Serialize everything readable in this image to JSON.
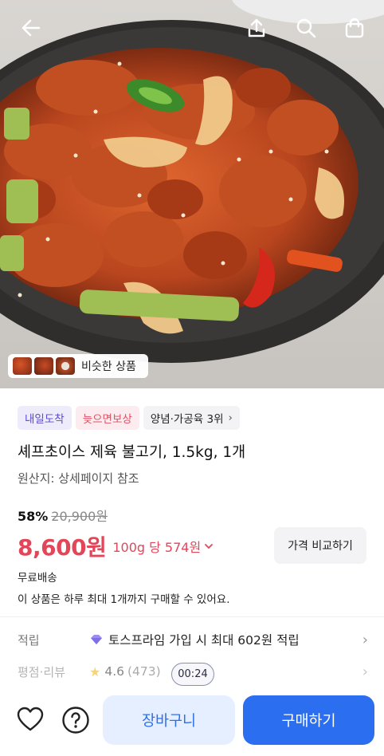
{
  "hero": {
    "similar_label": "비슷한 상품"
  },
  "badges": {
    "arrival": "내일도착",
    "late_comp": "늦으면보상",
    "rank": "양념·가공육 3위"
  },
  "product": {
    "title": "셰프초이스 제육 불고기, 1.5kg, 1개",
    "origin": "원산지: 상세페이지 참조",
    "discount": "58%",
    "original_price": "20,900원",
    "price": "8,600원",
    "unit_price": "100g 당 574원",
    "compare_label": "가격 비교하기",
    "shipping": "무료배송",
    "purchase_limit": "이 상품은 하루 최대 1개까지 구매할 수 있어요."
  },
  "details": {
    "points_key": "적립",
    "points_value": "토스프라임 가입 시 최대 602원 적립",
    "review_key": "평점·리뷰",
    "rating": "4.6",
    "review_count": "(473)",
    "timer": "00:24"
  },
  "actions": {
    "cart_label": "장바구니",
    "buy_label": "구매하기"
  },
  "icons": {
    "back": "arrow-left-icon",
    "share": "share-icon",
    "search": "search-icon",
    "cart": "shopping-bag-icon",
    "wish": "heart-icon",
    "help": "question-icon",
    "points": "gem-icon",
    "rating": "star-icon"
  },
  "colors": {
    "accent_red": "#e34659",
    "primary_blue": "#2c6ef0",
    "secondary_blue_bg": "#e6efff",
    "badge_purple": "#5b4bd0",
    "badge_pink": "#e04e63"
  }
}
